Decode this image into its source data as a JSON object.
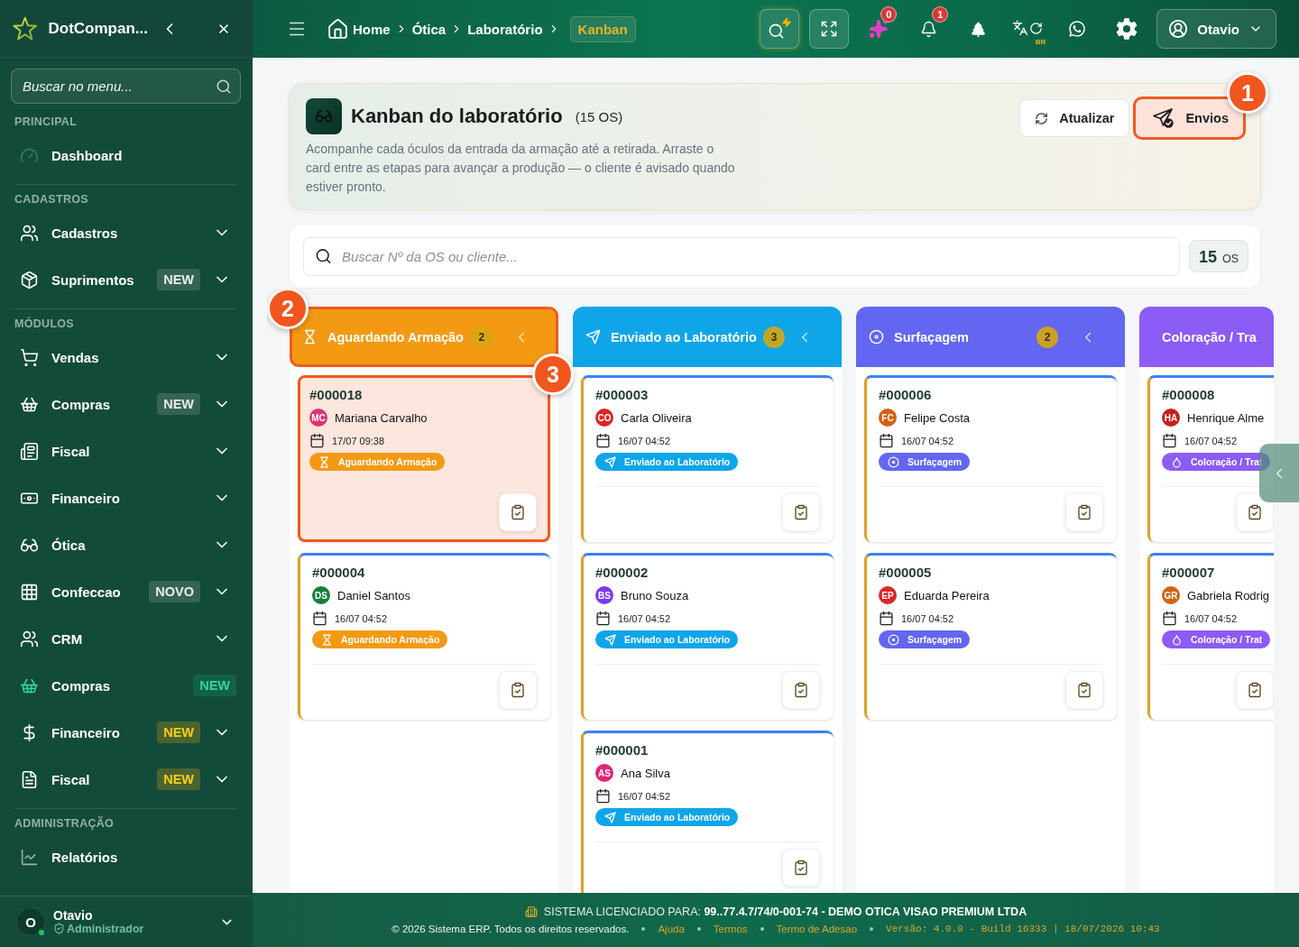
{
  "sidebar": {
    "brand": "DotCompan...",
    "search": {
      "placeholder": "Buscar no menu..."
    },
    "sections": [
      {
        "title": "PRINCIPAL",
        "items": [
          {
            "label": "Dashboard",
            "kind": "link"
          }
        ]
      },
      {
        "title": "CADASTROS",
        "items": [
          {
            "label": "Cadastros",
            "kind": "group"
          },
          {
            "label": "Suprimentos",
            "kind": "group",
            "badge": {
              "label": "NEW",
              "kind": "neutral"
            }
          }
        ]
      },
      {
        "title": "MÓDULOS",
        "items": [
          {
            "label": "Vendas",
            "kind": "group"
          },
          {
            "label": "Compras",
            "kind": "group",
            "badge": {
              "label": "NEW",
              "kind": "neutral"
            }
          },
          {
            "label": "Fiscal",
            "kind": "group"
          },
          {
            "label": "Financeiro",
            "kind": "group"
          },
          {
            "label": "Ótica",
            "kind": "group"
          },
          {
            "label": "Confeccao",
            "kind": "group",
            "badge": {
              "label": "NOVO",
              "kind": "neutral"
            }
          },
          {
            "label": "CRM",
            "kind": "group"
          },
          {
            "label": "Compras",
            "kind": "link",
            "badge": {
              "label": "NEW",
              "kind": "success"
            }
          },
          {
            "label": "Financeiro",
            "kind": "group",
            "badge": {
              "label": "NEW",
              "kind": "warning"
            }
          },
          {
            "label": "Fiscal",
            "kind": "group",
            "badge": {
              "label": "NEW",
              "kind": "warning"
            }
          }
        ]
      },
      {
        "title": "ADMINISTRAÇÃO",
        "items": [
          {
            "label": "Relatórios",
            "kind": "link"
          }
        ]
      }
    ],
    "user": {
      "initial": "O",
      "name": "Otavio",
      "role": "Administrador",
      "online": true
    }
  },
  "topbar": {
    "breadcrumb": [
      {
        "label": "Home",
        "current": false
      },
      {
        "label": "Ótica",
        "current": false
      },
      {
        "label": "Laboratório",
        "current": false
      },
      {
        "label": "Kanban",
        "current": true
      }
    ],
    "ai_badge": "0",
    "notification_badge": "1",
    "language": "BR",
    "user": "Otavio"
  },
  "header": {
    "title": "Kanban do laboratório",
    "count": "(15 OS)",
    "description": "Acompanhe cada óculos da entrada da armação até a retirada. Arraste o card entre as etapas para avançar a produção — o cliente é avisado quando estiver pronto.",
    "buttons": [
      {
        "label": "Atualizar",
        "kind": "refresh"
      },
      {
        "label": "Envios",
        "kind": "send",
        "tour_step": "1"
      }
    ]
  },
  "filter": {
    "placeholder": "Buscar Nº da OS ou cliente...",
    "total": "15",
    "unit": "OS"
  },
  "columns": [
    {
      "title": "Aguardando Armação",
      "count": "2",
      "color": "#f39a12",
      "truncated": false,
      "tour_step": "2",
      "cards": [
        {
          "number": "#000018",
          "initials": "MC",
          "color": "#e0336f",
          "customer": "Mariana Carvalho",
          "date": "17/07 09:38",
          "stage": "Aguardando Armação",
          "tour_step": "3"
        },
        {
          "number": "#000004",
          "initials": "DS",
          "color": "#15803d",
          "customer": "Daniel Santos",
          "date": "16/07 04:52",
          "stage": "Aguardando Armação"
        }
      ]
    },
    {
      "title": "Enviado ao Laboratório",
      "count": "3",
      "color": "#0ea5e9",
      "truncated": false,
      "cards": [
        {
          "number": "#000003",
          "initials": "CO",
          "color": "#dc2626",
          "customer": "Carla Oliveira",
          "date": "16/07 04:52",
          "stage": "Enviado ao Laboratório"
        },
        {
          "number": "#000002",
          "initials": "BS",
          "color": "#7c3aed",
          "customer": "Bruno Souza",
          "date": "16/07 04:52",
          "stage": "Enviado ao Laboratório"
        },
        {
          "number": "#000001",
          "initials": "AS",
          "color": "#db2777",
          "customer": "Ana Silva",
          "date": "16/07 04:52",
          "stage": "Enviado ao Laboratório"
        }
      ]
    },
    {
      "title": "Surfaçagem",
      "count": "2",
      "color": "#6366f1",
      "truncated": false,
      "cards": [
        {
          "number": "#000006",
          "initials": "FC",
          "color": "#d0620f",
          "customer": "Felipe Costa",
          "date": "16/07 04:52",
          "stage": "Surfaçagem"
        },
        {
          "number": "#000005",
          "initials": "EP",
          "color": "#dc2626",
          "customer": "Eduarda Pereira",
          "date": "16/07 04:52",
          "stage": "Surfaçagem"
        }
      ]
    },
    {
      "title": "Coloração / Tra",
      "color": "#8b5cf6",
      "truncated": true,
      "cards": [
        {
          "number": "#000008",
          "initials": "HA",
          "color": "#c81e1e",
          "customer": "Henrique Alme",
          "date": "16/07 04:52",
          "stage": "Coloração / Trat"
        },
        {
          "number": "#000007",
          "initials": "GR",
          "color": "#d0620f",
          "customer": "Gabriela Rodrig",
          "date": "16/07 04:52",
          "stage": "Coloração / Trat"
        }
      ]
    }
  ],
  "footer": {
    "license": "SISTEMA LICENCIADO PARA: **99..77.4.7/74/0-001-74 - DEMO OTICA VISAO PREMIUM LTDA**",
    "copyright": "© 2026 Sistema ERP. Todos os direitos reservados.",
    "links": [
      "Ajuda",
      "Termos",
      "Termo de Adesao"
    ],
    "version": "Versão: 4.0.0 - Build 16333 | 18/07/2026 10:43"
  }
}
